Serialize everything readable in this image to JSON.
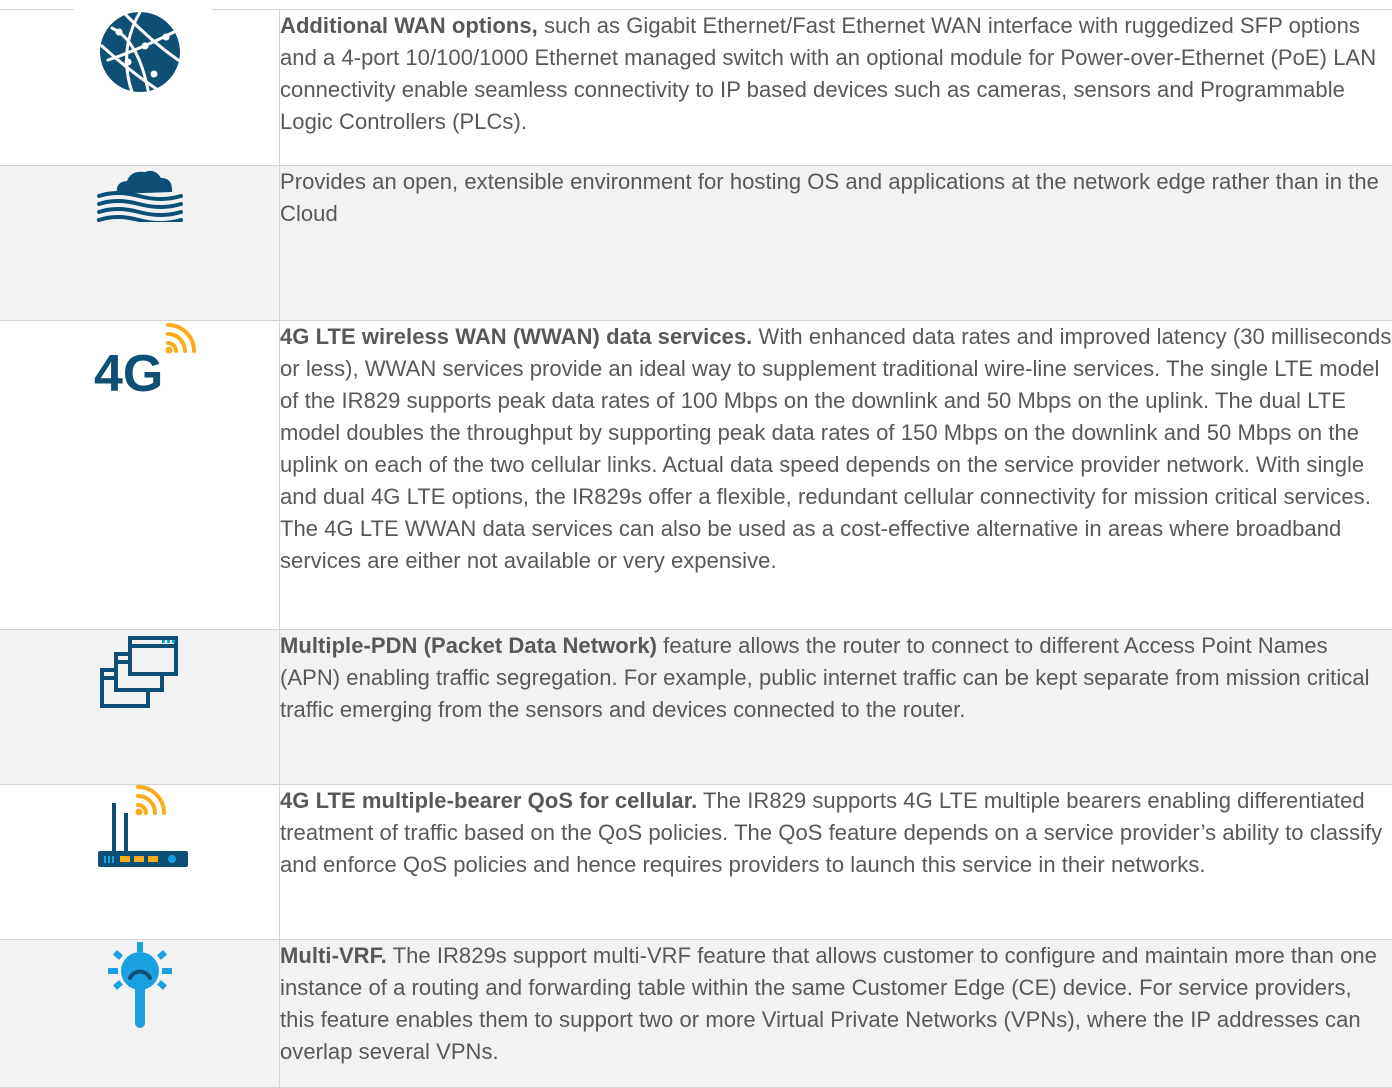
{
  "rows": [
    {
      "icon": "globe-network-icon",
      "lead": "Additional WAN options,",
      "body": " such as Gigabit Ethernet/Fast Ethernet WAN interface with ruggedized SFP options and a 4-port 10/100/1000 Ethernet managed switch with an optional module for Power-over-Ethernet (PoE) LAN connectivity enable seamless connectivity to IP based devices such as cameras, sensors and Programmable Logic Controllers (PLCs)."
    },
    {
      "icon": "fog-cloud-icon",
      "lead": "",
      "body": "Provides an open, extensible environment for hosting OS and applications at the network edge rather than in the Cloud"
    },
    {
      "icon": "4g-signal-icon",
      "icon_text": "4G",
      "lead": "4G LTE wireless WAN (WWAN) data services.",
      "body": " With enhanced data rates and improved latency (30 milliseconds or less), WWAN services provide an ideal way to supplement traditional wire-line services. The single LTE model of the IR829 supports peak data rates of 100 Mbps on the downlink and 50 Mbps on the uplink. The dual LTE model doubles the throughput by supporting peak data rates of 150 Mbps on the downlink and 50 Mbps on the uplink on each of the two cellular links. Actual data speed depends on the service provider network. With single and dual 4G LTE options, the IR829s offer a flexible, redundant cellular connectivity for mission critical services. The 4G LTE WWAN data services can also be used as a cost-effective alternative in areas where broadband services are either not available or very expensive."
    },
    {
      "icon": "stacked-windows-icon",
      "lead": "Multiple-PDN (Packet Data Network)",
      "body": " feature allows the router to connect to different Access Point Names (APN) enabling traffic segregation. For example, public internet traffic can be kept separate from mission critical traffic emerging from the sensors and devices connected to the router."
    },
    {
      "icon": "wireless-router-icon",
      "lead": "4G LTE multiple-bearer QoS for cellular.",
      "body": " The IR829 supports 4G LTE multiple bearers enabling differentiated treatment of traffic based on the QoS policies. The QoS feature depends on a service provider’s ability to classify and enforce QoS policies and hence requires providers to launch this service in their networks."
    },
    {
      "icon": "broadcast-antenna-icon",
      "lead": "Multi-VRF.",
      "body": " The IR829s support multi-VRF feature that allows customer to configure and maintain more than one instance of a routing and forwarding table within the same Customer Edge (CE) device. For service providers, this feature enables them to support two or more Virtual Private Networks (VPNs), where the IP addresses can overlap several VPNs."
    }
  ],
  "colors": {
    "icon_dark_blue": "#0d4f75",
    "icon_light_blue": "#1ba0e2",
    "icon_orange": "#fbab18",
    "text": "#58585b",
    "alt_row": "#f2f2f2",
    "border": "#d4d4d4"
  }
}
